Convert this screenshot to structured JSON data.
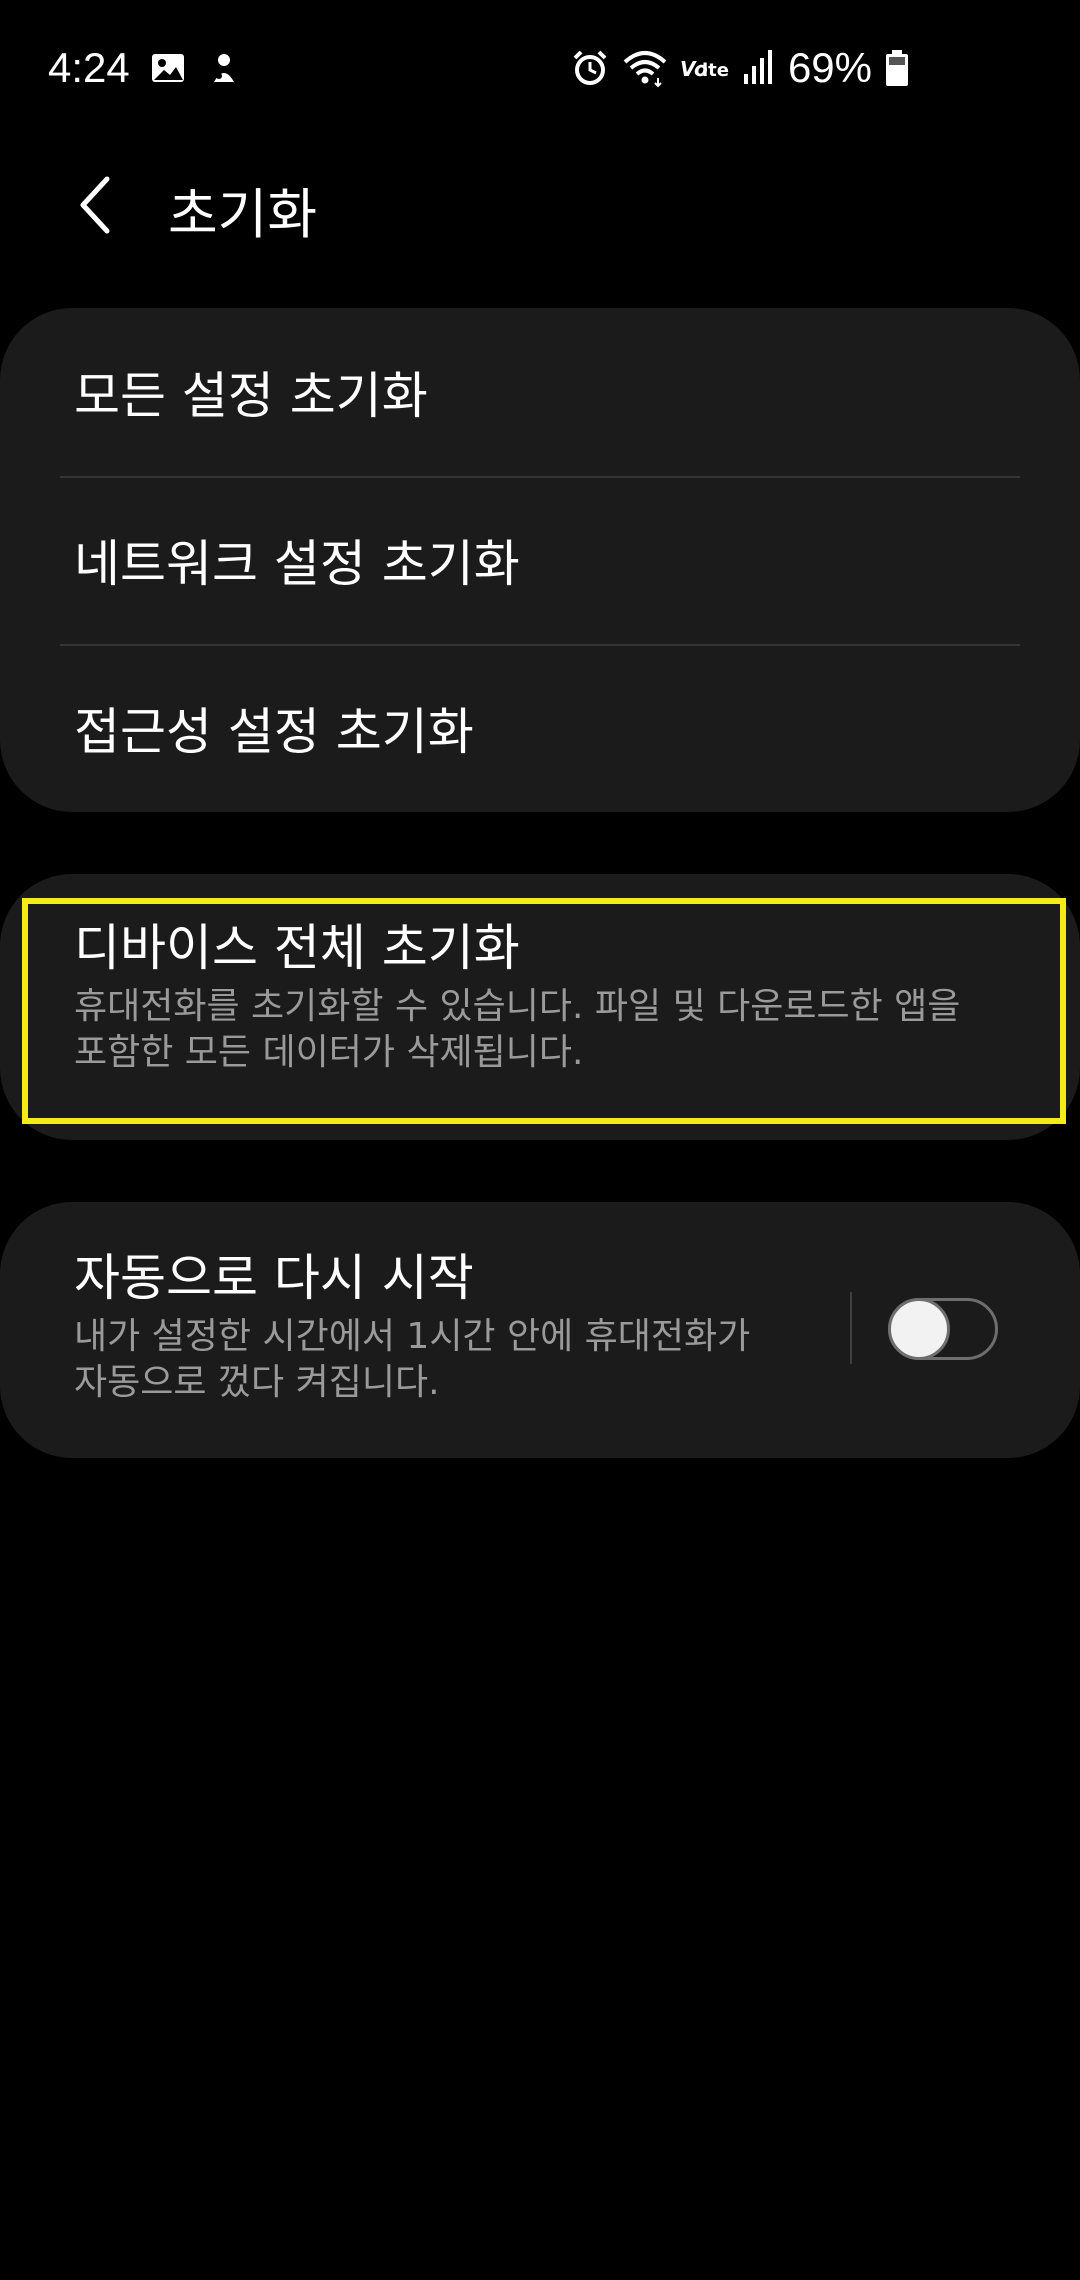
{
  "status_bar": {
    "time": "4:24",
    "battery_percent": "69%",
    "network_label": "Volte",
    "icons": [
      "image-icon",
      "app-notification-icon",
      "alarm-icon",
      "wifi-icon",
      "volte-icon",
      "signal-icon",
      "battery-icon"
    ]
  },
  "header": {
    "title": "초기화",
    "back_icon": "chevron-left-icon"
  },
  "reset_options": [
    {
      "label": "모든 설정 초기화"
    },
    {
      "label": "네트워크 설정 초기화"
    },
    {
      "label": "접근성 설정 초기화"
    }
  ],
  "factory_reset": {
    "title": "디바이스 전체 초기화",
    "description_line1": "휴대전화를 초기화할 수 있습니다. 파일 및 다운로드한 앱을",
    "description_line2": "포함한 모든 데이터가 삭제됩니다.",
    "highlight_color": "#f5ec17"
  },
  "auto_restart": {
    "title": "자동으로 다시 시작",
    "description_line1": "내가 설정한 시간에서 1시간 안에 휴대전화가",
    "description_line2": "자동으로 껐다 켜집니다.",
    "toggle_on": false
  },
  "colors": {
    "background": "#000000",
    "card": "#1b1b1b",
    "primary_text": "#ffffff",
    "secondary_text": "#9a9a9a"
  }
}
